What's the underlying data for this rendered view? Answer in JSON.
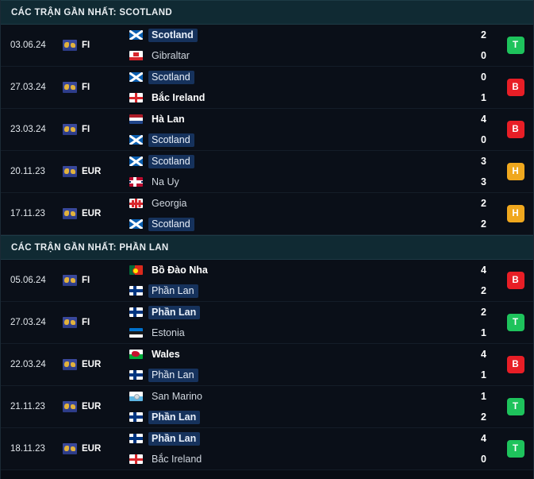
{
  "panel": {
    "sections": [
      {
        "id": "scotland",
        "header": "CÁC TRẬN GẦN NHẤT: SCOTLAND",
        "matches": [
          {
            "date": "03.06.24",
            "competition": "FI",
            "competition_icon": "world-globe-icon",
            "home": {
              "name": "Scotland",
              "flag": "scotland",
              "highlight": true,
              "bold": true
            },
            "away": {
              "name": "Gibraltar",
              "flag": "gibraltar",
              "highlight": false,
              "bold": false
            },
            "home_score": "2",
            "away_score": "0",
            "result": "T",
            "result_color": "#1ec35c"
          },
          {
            "date": "27.03.24",
            "competition": "FI",
            "competition_icon": "world-globe-icon",
            "home": {
              "name": "Scotland",
              "flag": "scotland",
              "highlight": true,
              "bold": false
            },
            "away": {
              "name": "Bắc Ireland",
              "flag": "nireland",
              "highlight": false,
              "bold": true
            },
            "home_score": "0",
            "away_score": "1",
            "result": "B",
            "result_color": "#e81e26"
          },
          {
            "date": "23.03.24",
            "competition": "FI",
            "competition_icon": "world-globe-icon",
            "home": {
              "name": "Hà Lan",
              "flag": "netherlands",
              "highlight": false,
              "bold": true
            },
            "away": {
              "name": "Scotland",
              "flag": "scotland",
              "highlight": true,
              "bold": false
            },
            "home_score": "4",
            "away_score": "0",
            "result": "B",
            "result_color": "#e81e26"
          },
          {
            "date": "20.11.23",
            "competition": "EUR",
            "competition_icon": "world-globe-icon",
            "home": {
              "name": "Scotland",
              "flag": "scotland",
              "highlight": true,
              "bold": false
            },
            "away": {
              "name": "Na Uy",
              "flag": "norway",
              "highlight": false,
              "bold": false
            },
            "home_score": "3",
            "away_score": "3",
            "result": "H",
            "result_color": "#f0a81e"
          },
          {
            "date": "17.11.23",
            "competition": "EUR",
            "competition_icon": "world-globe-icon",
            "home": {
              "name": "Georgia",
              "flag": "georgia",
              "highlight": false,
              "bold": false
            },
            "away": {
              "name": "Scotland",
              "flag": "scotland",
              "highlight": true,
              "bold": false
            },
            "home_score": "2",
            "away_score": "2",
            "result": "H",
            "result_color": "#f0a81e"
          }
        ]
      },
      {
        "id": "phan-lan",
        "header": "CÁC TRẬN GẦN NHẤT: PHẦN LAN",
        "matches": [
          {
            "date": "05.06.24",
            "competition": "FI",
            "competition_icon": "world-globe-icon",
            "home": {
              "name": "Bồ Đào Nha",
              "flag": "portugal",
              "highlight": false,
              "bold": true
            },
            "away": {
              "name": "Phần Lan",
              "flag": "finland",
              "highlight": true,
              "bold": false
            },
            "home_score": "4",
            "away_score": "2",
            "result": "B",
            "result_color": "#e81e26"
          },
          {
            "date": "27.03.24",
            "competition": "FI",
            "competition_icon": "world-globe-icon",
            "home": {
              "name": "Phần Lan",
              "flag": "finland",
              "highlight": true,
              "bold": true
            },
            "away": {
              "name": "Estonia",
              "flag": "estonia",
              "highlight": false,
              "bold": false
            },
            "home_score": "2",
            "away_score": "1",
            "result": "T",
            "result_color": "#1ec35c"
          },
          {
            "date": "22.03.24",
            "competition": "EUR",
            "competition_icon": "world-globe-icon",
            "home": {
              "name": "Wales",
              "flag": "wales",
              "highlight": false,
              "bold": true
            },
            "away": {
              "name": "Phần Lan",
              "flag": "finland",
              "highlight": true,
              "bold": false
            },
            "home_score": "4",
            "away_score": "1",
            "result": "B",
            "result_color": "#e81e26"
          },
          {
            "date": "21.11.23",
            "competition": "EUR",
            "competition_icon": "world-globe-icon",
            "home": {
              "name": "San Marino",
              "flag": "sanmarino",
              "highlight": false,
              "bold": false
            },
            "away": {
              "name": "Phần Lan",
              "flag": "finland",
              "highlight": true,
              "bold": true
            },
            "home_score": "1",
            "away_score": "2",
            "result": "T",
            "result_color": "#1ec35c"
          },
          {
            "date": "18.11.23",
            "competition": "EUR",
            "competition_icon": "world-globe-icon",
            "home": {
              "name": "Phần Lan",
              "flag": "finland",
              "highlight": true,
              "bold": true
            },
            "away": {
              "name": "Bắc Ireland",
              "flag": "nireland",
              "highlight": false,
              "bold": false
            },
            "home_score": "4",
            "away_score": "0",
            "result": "T",
            "result_color": "#1ec35c"
          }
        ]
      }
    ]
  },
  "colors": {
    "background": "#080c14",
    "row_background": "#0a0f18",
    "section_header_background": "#102a33",
    "highlight_background": "#16325c",
    "win": "#1ec35c",
    "loss": "#e81e26",
    "draw": "#f0a81e"
  }
}
